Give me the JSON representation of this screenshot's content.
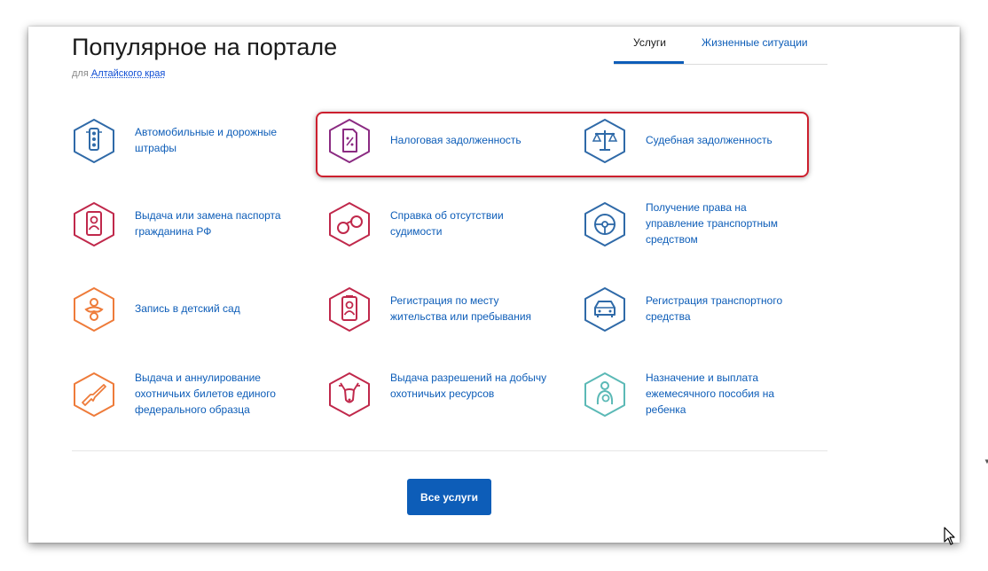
{
  "header": {
    "title": "Популярное на портале",
    "subtitle_prefix": "для",
    "region_link": "Алтайского края"
  },
  "tabs": [
    {
      "label": "Услуги",
      "active": true
    },
    {
      "label": "Жизненные ситуации",
      "active": false
    }
  ],
  "services": [
    {
      "label": "Автомобильные и дорожные штрафы",
      "icon": "traffic-light-icon",
      "color": "#2f6aa8"
    },
    {
      "label": "Налоговая задолженность",
      "icon": "tax-document-icon",
      "color": "#8b2b82"
    },
    {
      "label": "Судебная задолженность",
      "icon": "scales-icon",
      "color": "#2f6aa8"
    },
    {
      "label": "Выдача или замена паспорта гражданина РФ",
      "icon": "passport-icon",
      "color": "#c0284b"
    },
    {
      "label": "Справка об отсутствии судимости",
      "icon": "handcuffs-icon",
      "color": "#c0284b"
    },
    {
      "label": "Получение права на управление транспортным средством",
      "icon": "steering-wheel-icon",
      "color": "#2f6aa8"
    },
    {
      "label": "Запись в детский сад",
      "icon": "pacifier-icon",
      "color": "#ee7b3a"
    },
    {
      "label": "Регистрация по месту жительства или пребывания",
      "icon": "registration-document-icon",
      "color": "#c0284b"
    },
    {
      "label": "Регистрация транспортного средства",
      "icon": "car-icon",
      "color": "#2f6aa8"
    },
    {
      "label": "Выдача и аннулирование охотничьих билетов единого федерального образца",
      "icon": "rifle-icon",
      "color": "#ee7b3a"
    },
    {
      "label": "Выдача разрешений на добычу охотничьих ресурсов",
      "icon": "deer-icon",
      "color": "#c0284b"
    },
    {
      "label": "Назначение и выплата ежемесячного пособия на ребенка",
      "icon": "mother-child-icon",
      "color": "#5bb9b6"
    }
  ],
  "all_services_button": "Все услуги"
}
